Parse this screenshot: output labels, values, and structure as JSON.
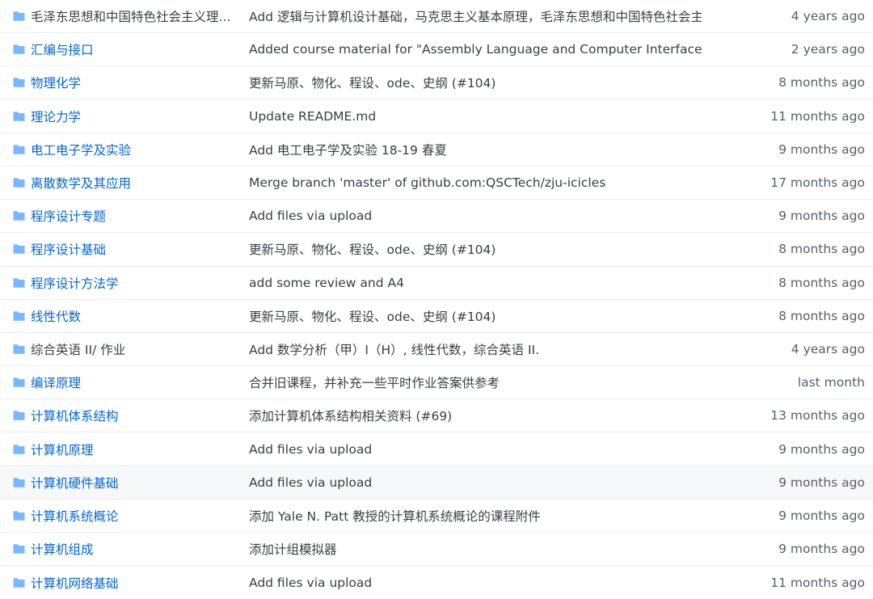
{
  "colors": {
    "link": "#0366d6",
    "folder_icon": "#79b8ff",
    "text": "#3a3f45",
    "muted": "#586069",
    "border": "#eaecef",
    "row_highlight": "#f6f8fa"
  },
  "rows": [
    {
      "icon": "folder-icon",
      "name": "毛泽东思想和中国特色社会主义理...",
      "message": "Add 逻辑与计算机设计基础，马克思主义基本原理，毛泽东思想和中国特色社会主",
      "age": "4 years ago",
      "name_style": "dim"
    },
    {
      "icon": "folder-icon",
      "name": "汇编与接口",
      "message": "Added course material for \"Assembly Language and Computer Interface\" ...",
      "age": "2 years ago"
    },
    {
      "icon": "folder-icon",
      "name": "物理化学",
      "message": "更新马原、物化、程设、ode、史纲 (#104)",
      "age": "8 months ago"
    },
    {
      "icon": "folder-icon",
      "name": "理论力学",
      "message": "Update README.md",
      "age": "11 months ago"
    },
    {
      "icon": "folder-icon",
      "name": "电工电子学及实验",
      "message": "Add 电工电子学及实验 18-19 春夏",
      "age": "9 months ago"
    },
    {
      "icon": "folder-icon",
      "name": "离散数学及其应用",
      "message": "Merge branch 'master' of github.com:QSCTech/zju-icicles",
      "age": "17 months ago"
    },
    {
      "icon": "folder-icon",
      "name": "程序设计专题",
      "message": "Add files via upload",
      "age": "9 months ago"
    },
    {
      "icon": "folder-icon",
      "name": "程序设计基础",
      "message": "更新马原、物化、程设、ode、史纲 (#104)",
      "age": "8 months ago"
    },
    {
      "icon": "folder-icon",
      "name": "程序设计方法学",
      "message": "add some review and A4",
      "age": "8 months ago"
    },
    {
      "icon": "folder-icon",
      "name": "线性代数",
      "message": "更新马原、物化、程设、ode、史纲 (#104)",
      "age": "8 months ago"
    },
    {
      "icon": "folder-icon",
      "name": "综合英语 II/ 作业",
      "message": "Add 数学分析（甲）I（H）, 线性代数，综合英语 II.",
      "age": "4 years ago",
      "name_style": "dim"
    },
    {
      "icon": "folder-icon",
      "name": "编译原理",
      "message": "合并旧课程，并补充一些平时作业答案供参考",
      "age": "last month"
    },
    {
      "icon": "folder-icon",
      "name": "计算机体系结构",
      "message": "添加计算机体系结构相关资料 (#69)",
      "age": "13 months ago"
    },
    {
      "icon": "folder-icon",
      "name": "计算机原理",
      "message": "Add files via upload",
      "age": "9 months ago"
    },
    {
      "icon": "folder-icon",
      "name": "计算机硬件基础",
      "message": "Add files via upload",
      "age": "9 months ago",
      "highlight": true
    },
    {
      "icon": "folder-icon",
      "name": "计算机系统概论",
      "message": "添加 Yale N. Patt 教授的计算机系统概论的课程附件",
      "age": "9 months ago"
    },
    {
      "icon": "folder-icon",
      "name": "计算机组成",
      "message": "添加计组模拟器",
      "age": "9 months ago"
    },
    {
      "icon": "folder-icon",
      "name": "计算机网络基础",
      "message": "Add files via upload",
      "age": "11 months ago"
    }
  ]
}
